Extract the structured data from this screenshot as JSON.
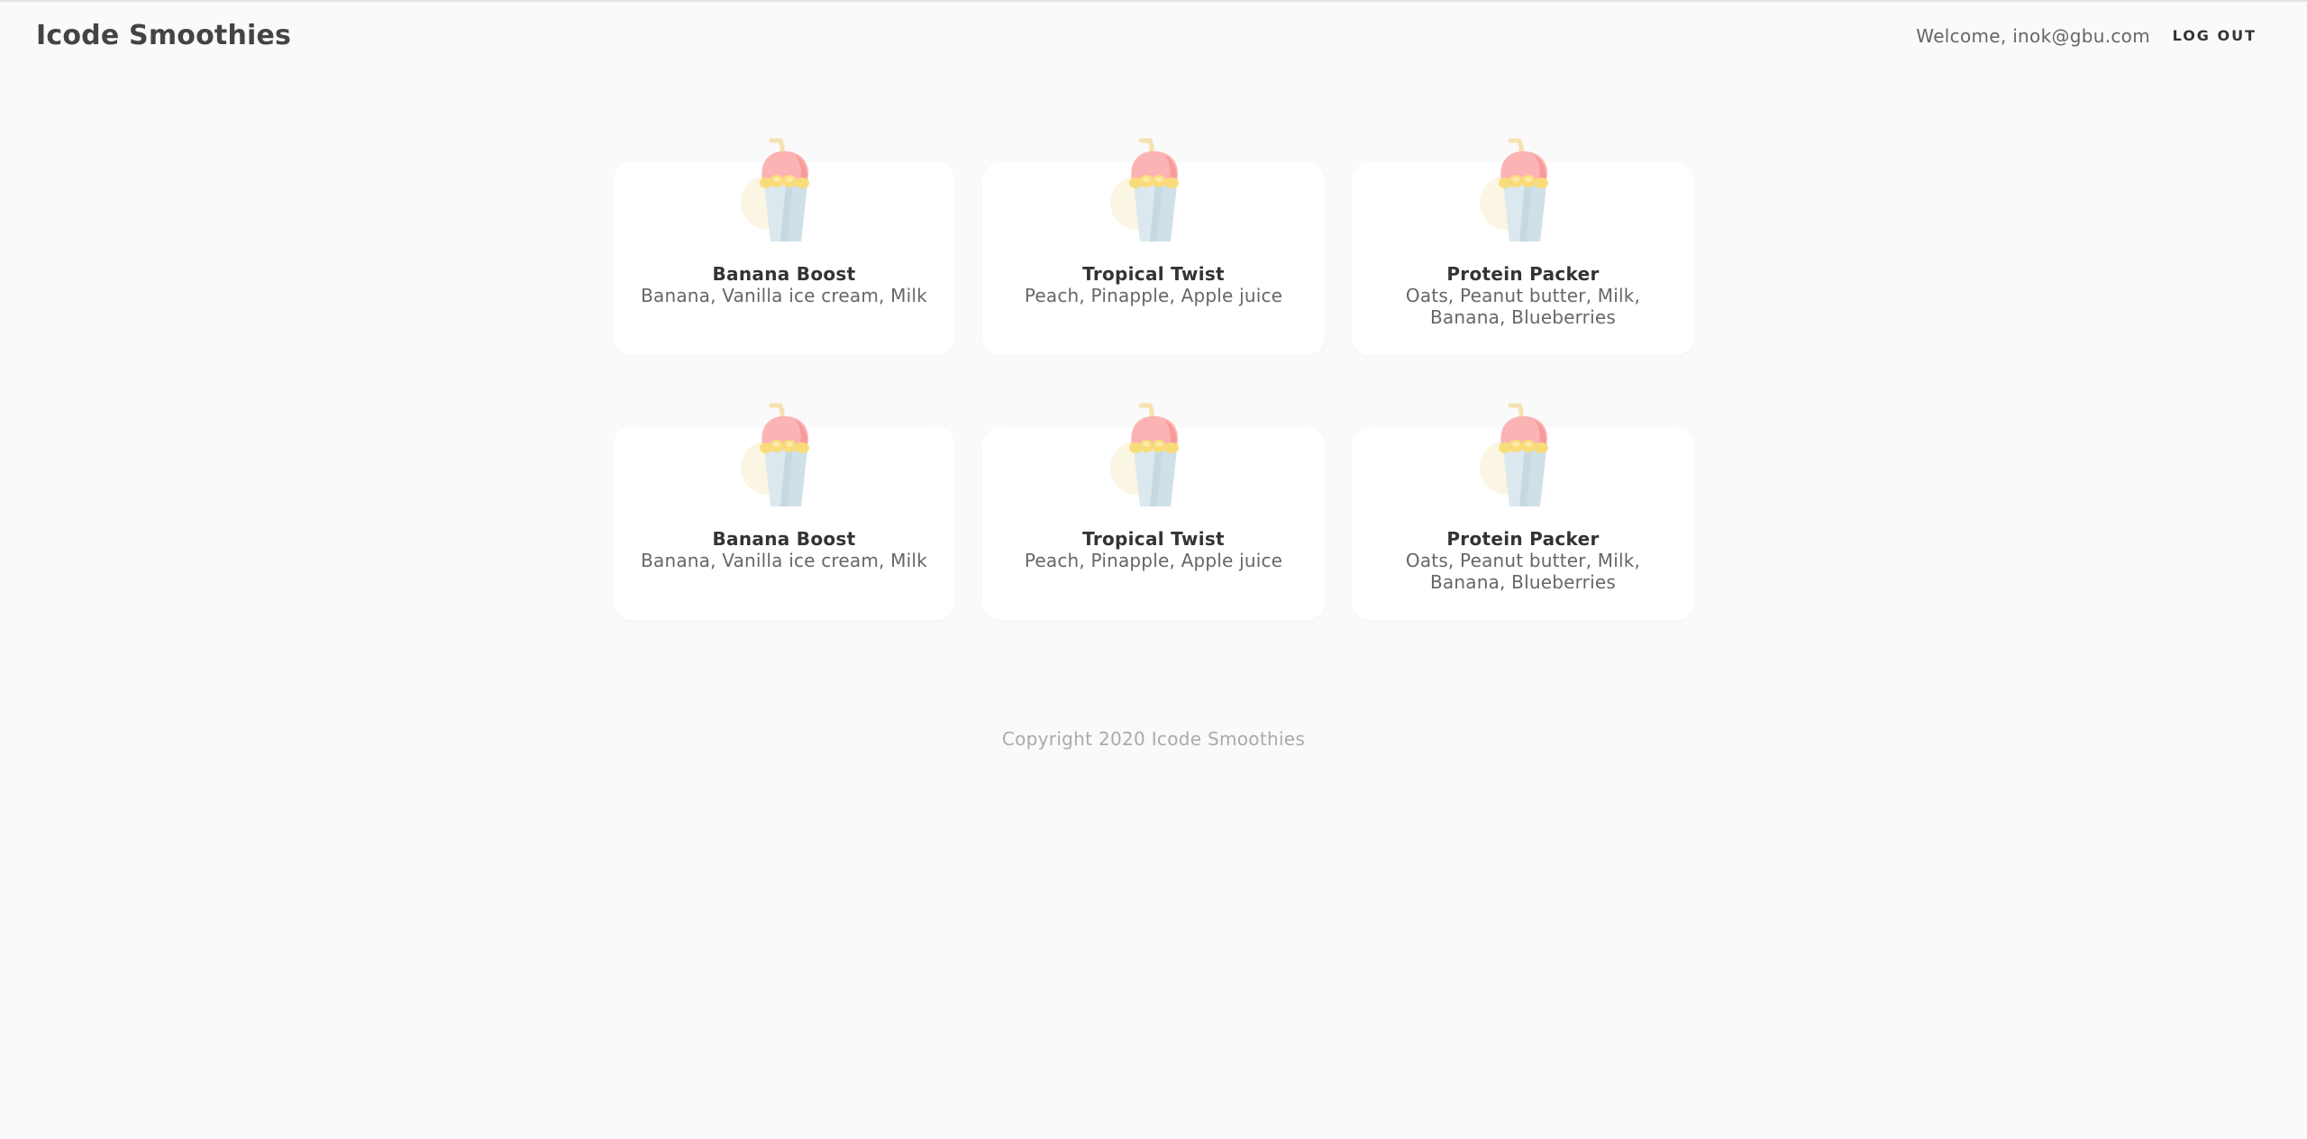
{
  "header": {
    "brand": "Icode Smoothies",
    "welcome": "Welcome, inok@gbu.com",
    "logout_label": "LOG OUT"
  },
  "smoothies": [
    {
      "title": "Banana Boost",
      "ingredients": "Banana, Vanilla ice cream, Milk",
      "icon": "smoothie-cup-icon"
    },
    {
      "title": "Tropical Twist",
      "ingredients": "Peach, Pinapple, Apple juice",
      "icon": "smoothie-cup-icon"
    },
    {
      "title": "Protein Packer",
      "ingredients": "Oats, Peanut butter, Milk, Banana, Blueberries",
      "icon": "smoothie-cup-icon"
    },
    {
      "title": "Banana Boost",
      "ingredients": "Banana, Vanilla ice cream, Milk",
      "icon": "smoothie-cup-icon"
    },
    {
      "title": "Tropical Twist",
      "ingredients": "Peach, Pinapple, Apple juice",
      "icon": "smoothie-cup-icon"
    },
    {
      "title": "Protein Packer",
      "ingredients": "Oats, Peanut butter, Milk, Banana, Blueberries",
      "icon": "smoothie-cup-icon"
    }
  ],
  "footer": {
    "copyright": "Copyright 2020 Icode Smoothies"
  },
  "colors": {
    "background": "#fafafa",
    "card": "#ffffff",
    "smoothie_pink": "#fcb3b3",
    "smoothie_yellow": "#f9dc7a",
    "cup_blue": "#d5e5ec",
    "halo_cream": "#faf6e3"
  }
}
